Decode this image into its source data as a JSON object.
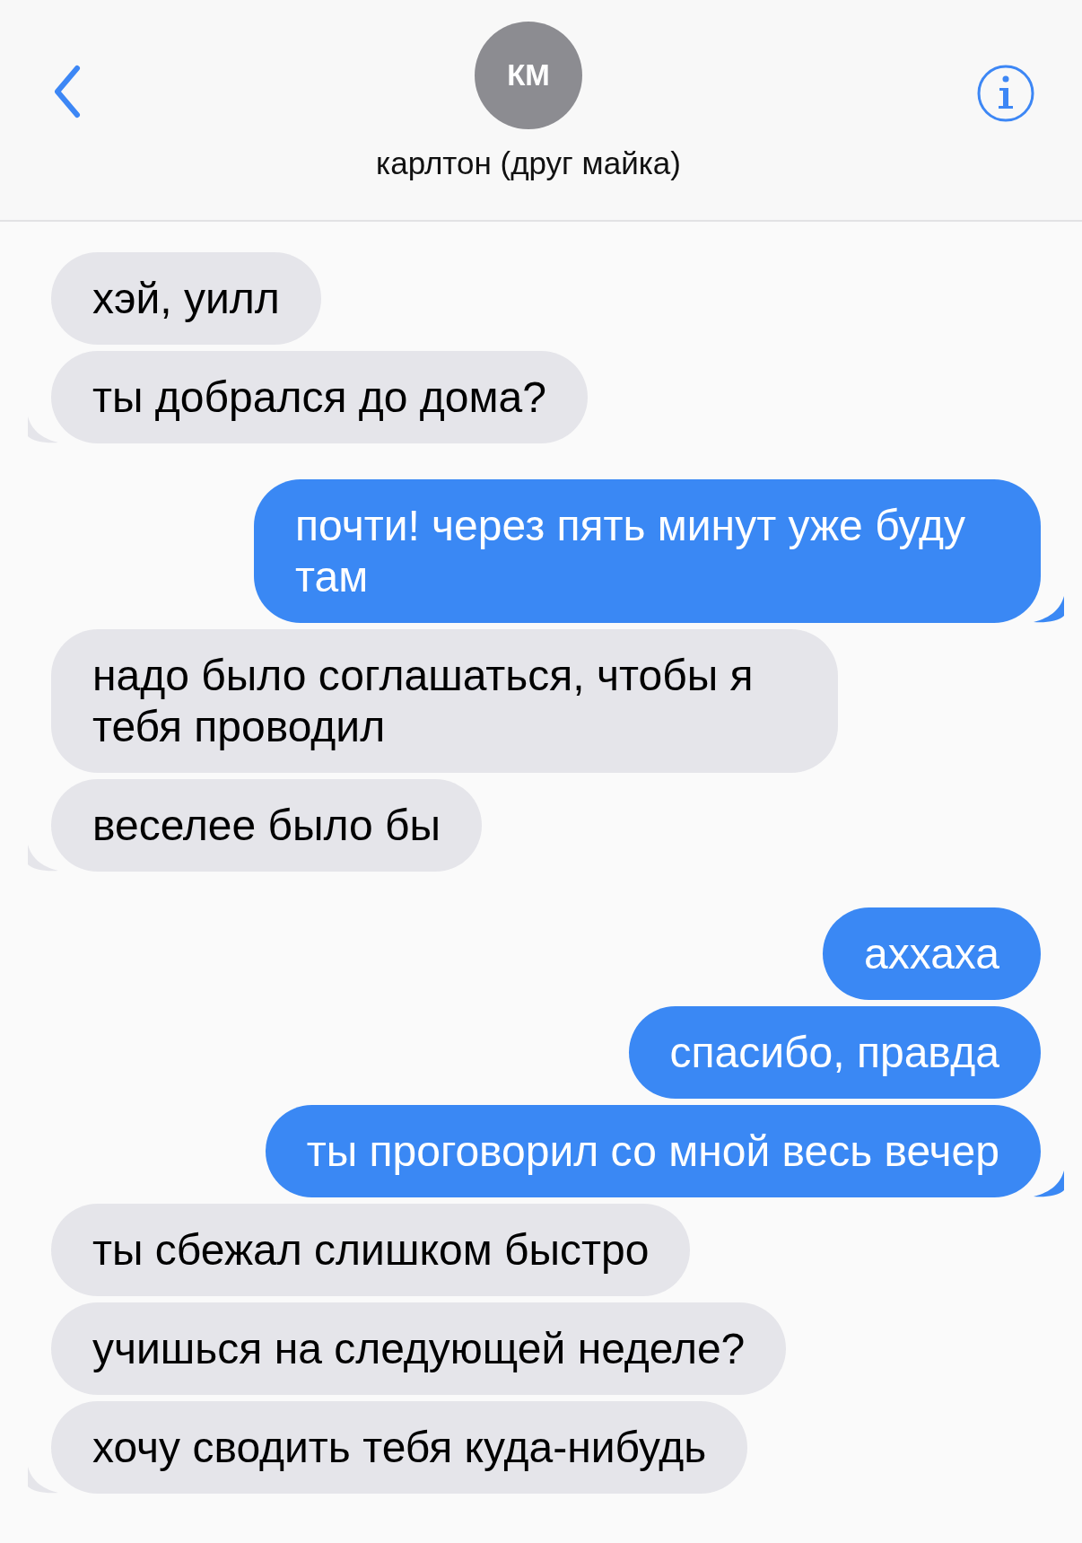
{
  "contact": {
    "initials": "КМ",
    "name": "карлтон (друг майка)"
  },
  "groups": [
    {
      "kind": "received",
      "messages": [
        "хэй, уилл",
        "ты добрался до дома?"
      ]
    },
    {
      "kind": "sent",
      "messages": [
        "почти! через пять минут уже буду там"
      ]
    },
    {
      "kind": "received",
      "messages": [
        "надо было соглашаться, чтобы я тебя проводил",
        "веселее было бы"
      ]
    },
    {
      "kind": "sent",
      "messages": [
        "аххаха",
        "спасибо, правда",
        "ты проговорил со мной весь вечер"
      ]
    },
    {
      "kind": "received",
      "messages": [
        "ты сбежал слишком быстро",
        "учишься на следующей неделе?",
        "хочу сводить тебя куда-нибудь"
      ]
    }
  ]
}
